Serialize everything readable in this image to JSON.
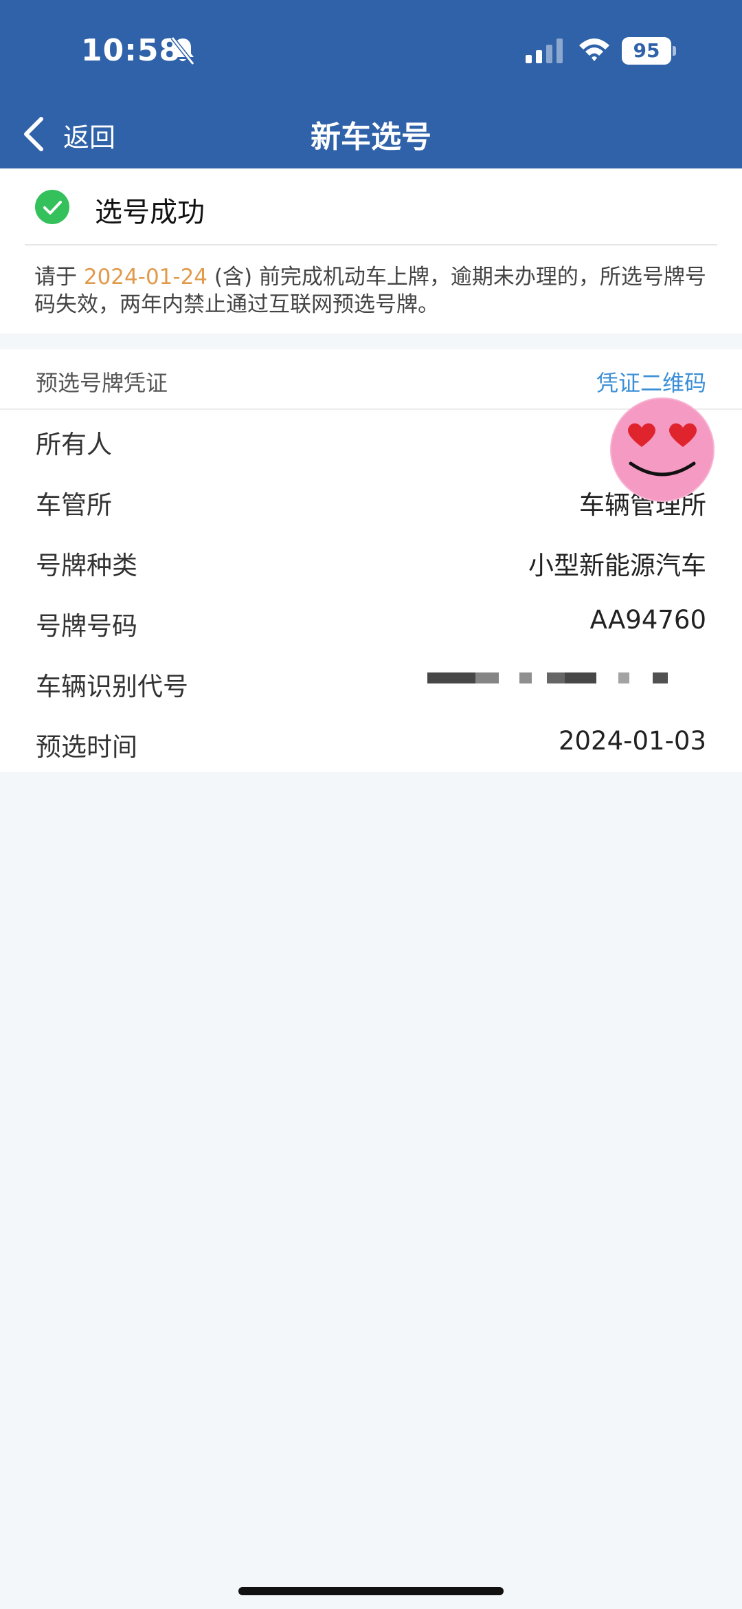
{
  "status_bar": {
    "time": "10:58",
    "battery": "95"
  },
  "nav": {
    "back_label": "返回",
    "title": "新车选号"
  },
  "success": {
    "text": "选号成功",
    "notice_prefix": "请于 ",
    "notice_date": "2024-01-24",
    "notice_suffix": " (含) 前完成机动车上牌，逾期未办理的，所选号牌号码失效，两年内禁止通过互联网预选号牌。"
  },
  "details": {
    "title": "预选号牌凭证",
    "qr_link": "凭证二维码",
    "rows": [
      {
        "label": "所有人",
        "value": ""
      },
      {
        "label": "车管所",
        "value": "车辆管理所"
      },
      {
        "label": "号牌种类",
        "value": "小型新能源汽车"
      },
      {
        "label": "号牌号码",
        "value": "AA94760"
      },
      {
        "label": "车辆识别代号",
        "value": ""
      },
      {
        "label": "预选时间",
        "value": "2024-01-03"
      }
    ]
  },
  "colors": {
    "header_bg": "#2f62a8",
    "success_green": "#34c05a",
    "date_orange": "#e29a4b",
    "link_blue": "#3b8fd8"
  },
  "icons": [
    "bell-slash-icon",
    "cellular-signal-icon",
    "wifi-icon",
    "chevron-left-icon",
    "check-circle-icon",
    "heart-eyes-emoji-sticker"
  ]
}
